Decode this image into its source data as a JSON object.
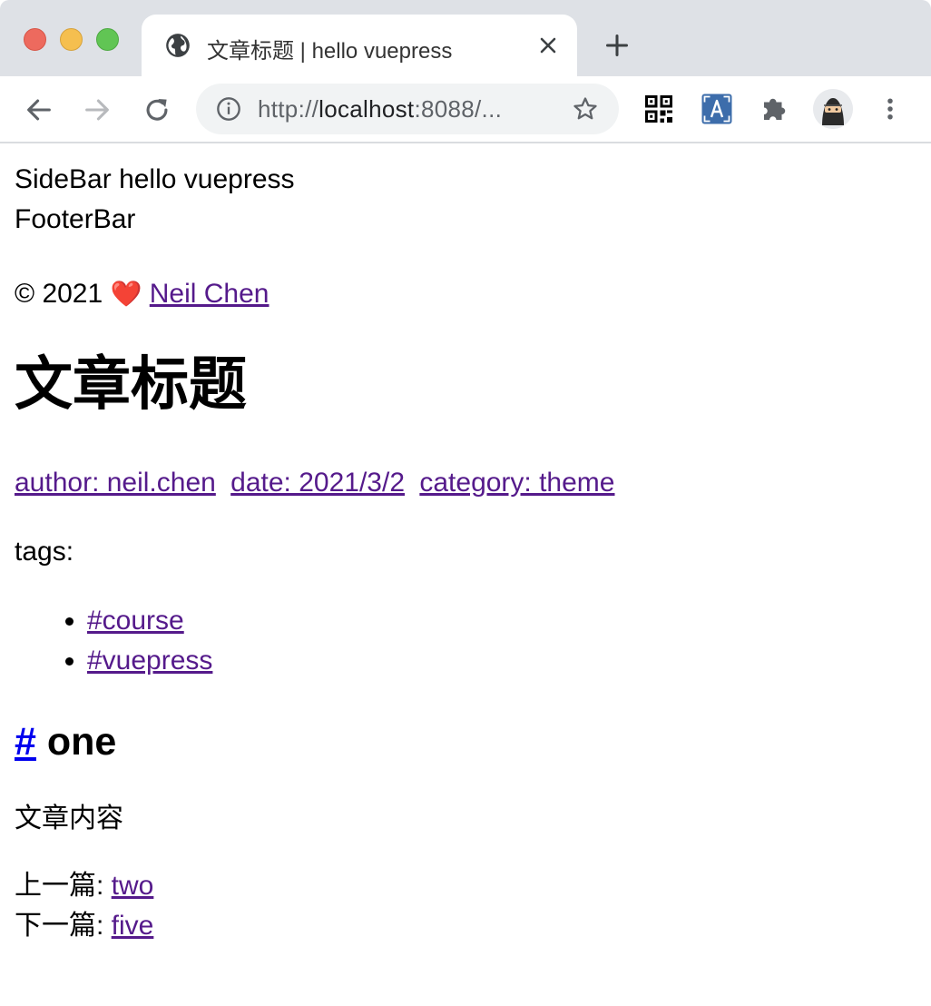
{
  "browser": {
    "tab_title": "文章标题 | hello vuepress",
    "url_scheme": "http://",
    "url_host": "localhost",
    "url_rest": ":8088/..."
  },
  "page": {
    "sidebar_text": "SideBar hello vuepress",
    "footer_text": "FooterBar",
    "copyright_prefix": "© 2021",
    "copyright_heart": "❤️",
    "author_link": "Neil Chen",
    "title": "文章标题",
    "meta": {
      "author": "author: neil.chen",
      "date": "date: 2021/3/2",
      "category": "category: theme"
    },
    "tags_label": "tags:",
    "tags": [
      "#course",
      "#vuepress"
    ],
    "section_anchor": "#",
    "section_title": "one",
    "content": "文章内容",
    "prev_label": "上一篇: ",
    "prev_link": "two",
    "next_label": "下一篇: ",
    "next_link": "five"
  }
}
